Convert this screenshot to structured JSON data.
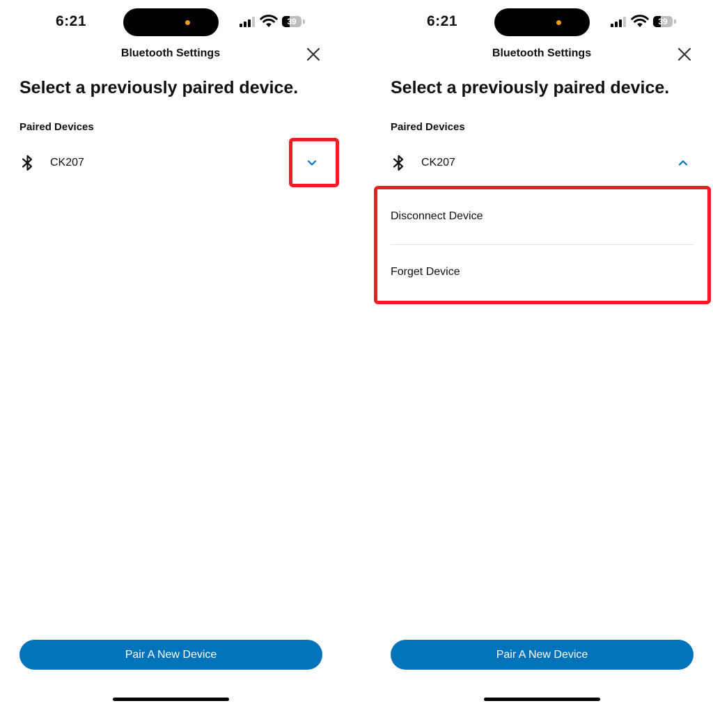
{
  "status_bar": {
    "time": "6:21",
    "battery": "39",
    "battery_level_percent": 39,
    "signal_bars_active": 3,
    "signal_bars_total": 4
  },
  "header": {
    "title": "Bluetooth Settings",
    "close_icon": "close-icon"
  },
  "page": {
    "title": "Select a previously paired device.",
    "section_label": "Paired Devices"
  },
  "device": {
    "name": "CK207",
    "icon": "bluetooth-icon"
  },
  "device_menu": {
    "items": [
      "Disconnect Device",
      "Forget Device"
    ]
  },
  "footer": {
    "pair_button_label": "Pair A New Device"
  },
  "colors": {
    "accent": "#0073bb",
    "highlight": "#ee1d23",
    "text": "#0f1111",
    "divider": "#e3e6e6"
  }
}
